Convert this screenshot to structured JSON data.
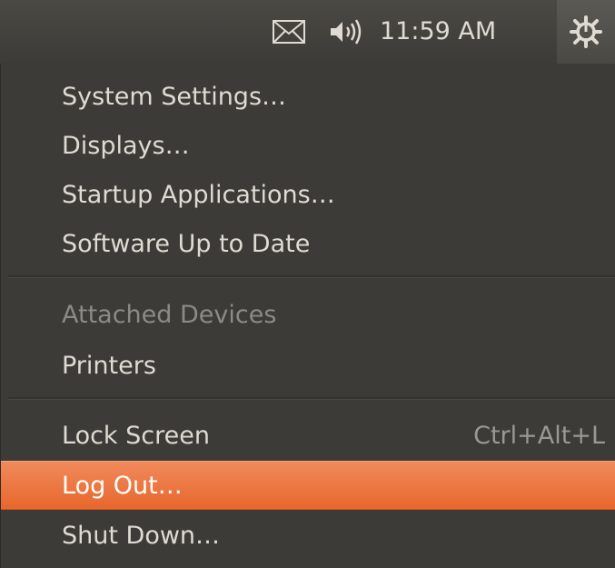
{
  "panel": {
    "clock": "11:59 AM",
    "icons": [
      "mail-icon",
      "speaker-icon",
      "power-gear-icon"
    ]
  },
  "menu": {
    "system_settings": "System Settings…",
    "displays": "Displays…",
    "startup_apps": "Startup Applications…",
    "software_update": "Software Up to Date",
    "attached_devices": "Attached Devices",
    "printers": "Printers",
    "lock_screen": "Lock Screen",
    "lock_shortcut": "Ctrl+Alt+L",
    "log_out": "Log Out…",
    "shut_down": "Shut Down…"
  },
  "colors": {
    "menu_bg": "#3c3b37",
    "highlight": "#e9703a",
    "text": "#dfdbd2",
    "disabled_text": "#8c8a84"
  }
}
